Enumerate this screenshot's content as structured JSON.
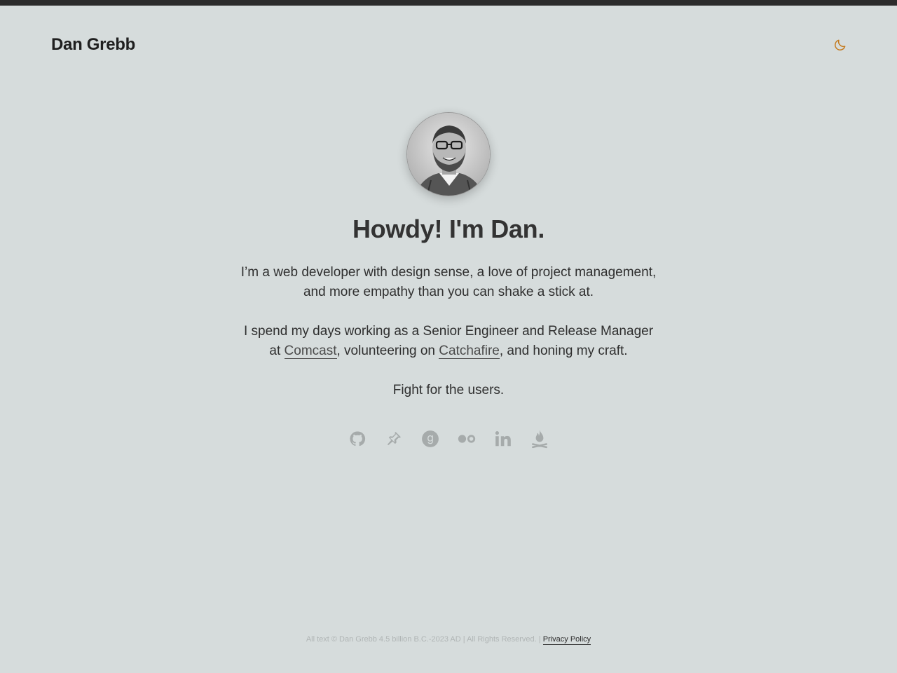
{
  "header": {
    "site_title": "Dan Grebb",
    "theme_toggle_icon": "moon-icon",
    "accent_color": "#c47a1e"
  },
  "hero": {
    "avatar_alt": "Dan Grebb",
    "headline": "Howdy! I'm Dan.",
    "intro": "I’m a web developer with design sense, a love of project management, and more empathy than you can shake a stick at.",
    "work": {
      "before": "I spend my days working as a Senior Engineer and Release Manager at ",
      "link1": "Comcast",
      "middle": ", volunteering on ",
      "link2": "Catchafire",
      "after": ", and honing my craft."
    },
    "motto": "Fight for the users."
  },
  "social": [
    {
      "icon": "github-icon"
    },
    {
      "icon": "pinboard-icon"
    },
    {
      "icon": "goodreads-icon"
    },
    {
      "icon": "flickr-icon"
    },
    {
      "icon": "linkedin-icon"
    },
    {
      "icon": "campfire-icon"
    }
  ],
  "footer": {
    "copyright": "All text © Dan Grebb 4.5 billion B.C.-2023 AD | All Rights Reserved. |",
    "privacy_link": "Privacy Policy"
  }
}
